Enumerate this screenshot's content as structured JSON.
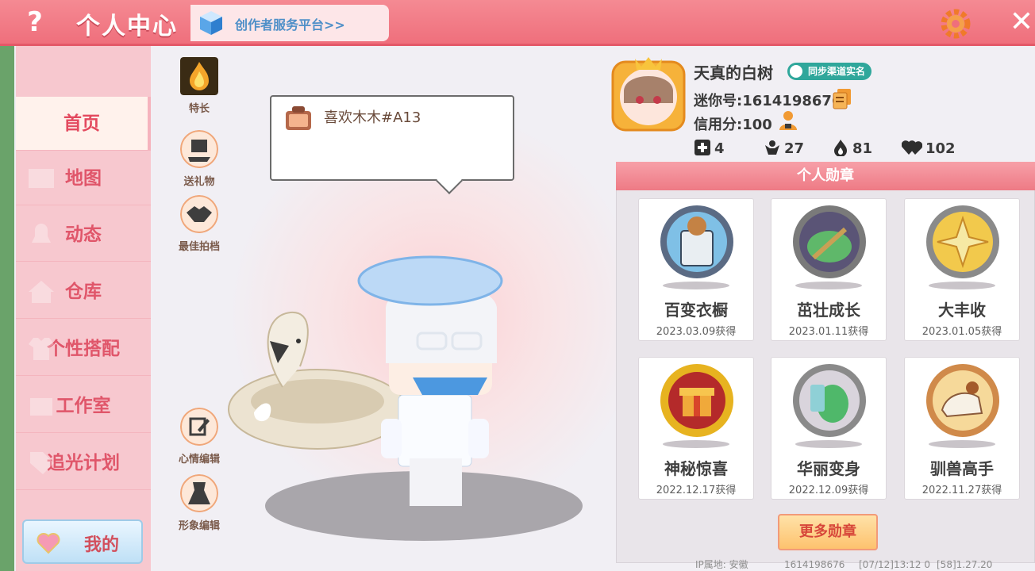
{
  "header": {
    "help_label": "?",
    "title": "个人中心",
    "creator_link": "创作者服务平台>>",
    "close_label": "✕"
  },
  "sidebar": {
    "items": [
      {
        "label": "首页",
        "active": true
      },
      {
        "label": "地图"
      },
      {
        "label": "动态"
      },
      {
        "label": "仓库"
      },
      {
        "label": "个性搭配"
      },
      {
        "label": "工作室"
      },
      {
        "label": "追光计划"
      }
    ],
    "me_label": "我的"
  },
  "actions": {
    "talent": "特长",
    "gift": "送礼物",
    "partner": "最佳拍档",
    "mood_edit": "心情编辑",
    "look_edit": "形象编辑"
  },
  "mood": {
    "text": "喜欢木木#A13"
  },
  "profile": {
    "nickname": "天真的白树",
    "realname_badge": "同步渠道实名",
    "mini_id": "迷你号:1614198676",
    "credit": "信用分:100",
    "stats": {
      "friends": "4",
      "fans": "27",
      "heat": "81",
      "likes": "102"
    }
  },
  "medals": {
    "title": "个人勋章",
    "items": [
      {
        "name": "百变衣橱",
        "date": "2023.03.09获得",
        "style": "blue"
      },
      {
        "name": "茁壮成长",
        "date": "2023.01.11获得",
        "style": "silver"
      },
      {
        "name": "大丰收",
        "date": "2023.01.05获得",
        "style": "silver-gold"
      },
      {
        "name": "神秘惊喜",
        "date": "2022.12.17获得",
        "style": "gold"
      },
      {
        "name": "华丽变身",
        "date": "2022.12.09获得",
        "style": "silver"
      },
      {
        "name": "驯兽高手",
        "date": "2022.11.27获得",
        "style": "bronze"
      }
    ],
    "more_label": "更多勋章"
  },
  "footer": {
    "ip": "IP属地: 安徽",
    "uid": "1614198676",
    "time": "[07/12]13:12 0",
    "version": "[58]1.27.20"
  },
  "colors": {
    "accent": "#ef6f7c",
    "sidebar": "#f7c8cf",
    "teal": "#2fa79b"
  }
}
